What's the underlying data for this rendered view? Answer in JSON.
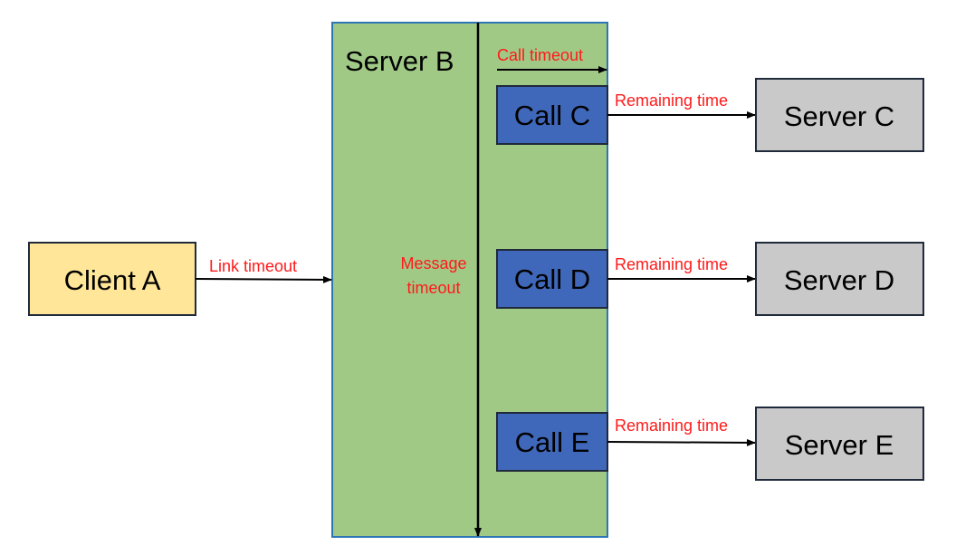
{
  "nodes": {
    "client_a": {
      "label": "Client A",
      "color": "#FFE699"
    },
    "server_b": {
      "label": "Server B",
      "color": "#A1C986"
    },
    "call_c": {
      "label": "Call C",
      "color": "#4068BA"
    },
    "call_d": {
      "label": "Call D",
      "color": "#4068BA"
    },
    "call_e": {
      "label": "Call E",
      "color": "#4068BA"
    },
    "server_c": {
      "label": "Server C",
      "color": "#C9C9C9"
    },
    "server_d": {
      "label": "Server D",
      "color": "#C9C9C9"
    },
    "server_e": {
      "label": "Server E",
      "color": "#C9C9C9"
    }
  },
  "edges": {
    "link_timeout": "Link timeout",
    "message_timeout_line1": "Message",
    "message_timeout_line2": "timeout",
    "call_timeout": "Call timeout",
    "remaining_c": "Remaining time",
    "remaining_d": "Remaining time",
    "remaining_e": "Remaining time"
  },
  "label_color": "#FF1A1A"
}
